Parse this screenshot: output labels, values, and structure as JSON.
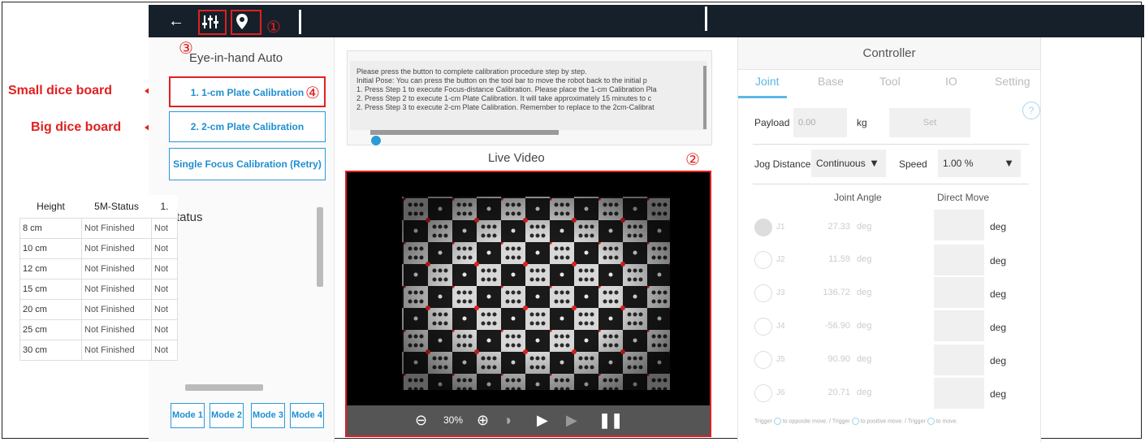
{
  "annotations": {
    "small_board": "Small dice board",
    "big_board": "Big dice board",
    "n1": "①",
    "n2": "②",
    "n3": "③",
    "n4": "④"
  },
  "toolbar": {
    "back_icon": "arrow-left-icon",
    "adjust_icon": "sliders-icon",
    "pin_icon": "location-pin-icon"
  },
  "left": {
    "title": "Eye-in-hand Auto",
    "btn1": "1. 1-cm Plate Calibration",
    "btn2": "2. 2-cm Plate Calibration",
    "btn3": "Single Focus Calibration (Retry)",
    "status_title": "Status",
    "columns": [
      "Height",
      "5M-Status",
      "1."
    ],
    "rows": [
      [
        "8 cm",
        "Not Finished",
        "Not"
      ],
      [
        "10 cm",
        "Not Finished",
        "Not"
      ],
      [
        "12 cm",
        "Not Finished",
        "Not"
      ],
      [
        "15 cm",
        "Not Finished",
        "Not"
      ],
      [
        "20 cm",
        "Not Finished",
        "Not"
      ],
      [
        "25 cm",
        "Not Finished",
        "Not"
      ],
      [
        "30 cm",
        "Not Finished",
        "Not"
      ]
    ],
    "modes": [
      "Mode 1",
      "Mode 2",
      "Mode 3",
      "Mode 4"
    ]
  },
  "instructions": {
    "lines": [
      "Please press the button to complete calibration procedure step by step.",
      "Initial Pose: You can press the button on the tool bar to move the robot back to the initial p",
      "1. Press Step 1 to execute Focus-distance Calibration. Please place the 1-cm Calibration Pla",
      "2. Press Step 2 to execute 1-cm Plate Calibration. It will take approximately 15 minutes to c",
      "2. Press Step 3 to execute 2-cm Plate Calibration. Remember to replace to the 2cm-Calibrat"
    ]
  },
  "video": {
    "title": "Live Video",
    "zoom": "30%"
  },
  "controller": {
    "title": "Controller",
    "tabs": [
      "Joint",
      "Base",
      "Tool",
      "IO",
      "Setting"
    ],
    "payload_label": "Payload",
    "payload_value": "0.00",
    "payload_unit": "kg",
    "set_label": "Set",
    "jog_label": "Jog Distance",
    "jog_value": "Continuous",
    "speed_label": "Speed",
    "speed_value": "1.00 %",
    "col_joint_angle": "Joint Angle",
    "col_direct_move": "Direct Move",
    "joints": [
      {
        "name": "J1",
        "value": "27.33",
        "unit": "deg",
        "dm_unit": "deg"
      },
      {
        "name": "J2",
        "value": "11.59",
        "unit": "deg",
        "dm_unit": "deg"
      },
      {
        "name": "J3",
        "value": "136.72",
        "unit": "deg",
        "dm_unit": "deg"
      },
      {
        "name": "J4",
        "value": "-56.90",
        "unit": "deg",
        "dm_unit": "deg"
      },
      {
        "name": "J5",
        "value": "90.90",
        "unit": "deg",
        "dm_unit": "deg"
      },
      {
        "name": "J6",
        "value": "20.71",
        "unit": "deg",
        "dm_unit": "deg"
      }
    ],
    "footer": {
      "t1": "Trigger",
      "t2": "to opposite move.",
      "t3": "/  Trigger",
      "t4": "to positive move.",
      "t5": "/  Trigger",
      "t6": "to move."
    }
  },
  "colors": {
    "annotation_red": "#e02020",
    "accent_blue": "#2a9ad8",
    "topbar": "#16202a"
  }
}
